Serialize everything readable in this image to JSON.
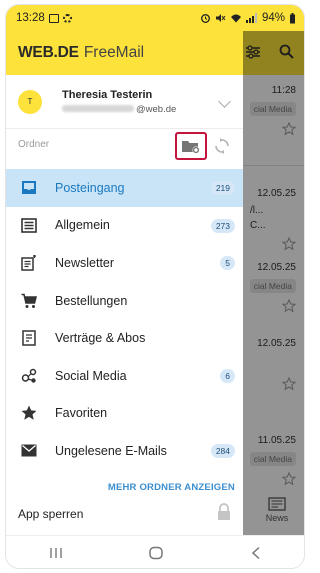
{
  "status_bar": {
    "time": "13:28",
    "battery": "94%"
  },
  "app": {
    "logo": "WEB.DE",
    "product": "FreeMail"
  },
  "account": {
    "initials": "T",
    "name": "Theresia Testerin",
    "email_domain": "@web.de"
  },
  "folders": {
    "section_label": "Ordner",
    "items": [
      {
        "label": "Posteingang",
        "count": "219",
        "icon": "inbox-icon",
        "active": true
      },
      {
        "label": "Allgemein",
        "count": "273",
        "icon": "list-icon"
      },
      {
        "label": "Newsletter",
        "count": "5",
        "icon": "newsletter-icon"
      },
      {
        "label": "Bestellungen",
        "count": "",
        "icon": "cart-icon"
      },
      {
        "label": "Verträge & Abos",
        "count": "",
        "icon": "contract-icon"
      },
      {
        "label": "Social Media",
        "count": "6",
        "icon": "social-icon"
      },
      {
        "label": "Favoriten",
        "count": "",
        "icon": "star-icon"
      },
      {
        "label": "Ungelesene E-Mails",
        "count": "284",
        "icon": "mail-icon"
      }
    ],
    "more_label": "MEHR ORDNER ANZEIGEN"
  },
  "app_lock_label": "App sperren",
  "background_list": {
    "times": [
      "11:28",
      "12.05.25",
      "12.05.25",
      "12.05.25",
      "11.05.25"
    ],
    "tags": [
      "cial Media",
      "cial Media",
      "cial Media"
    ],
    "snippets": [
      "/l...",
      "C..."
    ],
    "news_label": "News"
  },
  "colors": {
    "brand_yellow": "#fce23a",
    "active_bg": "#c9e4f6",
    "accent_blue": "#1c79c0",
    "highlight_red": "#c4143c"
  }
}
